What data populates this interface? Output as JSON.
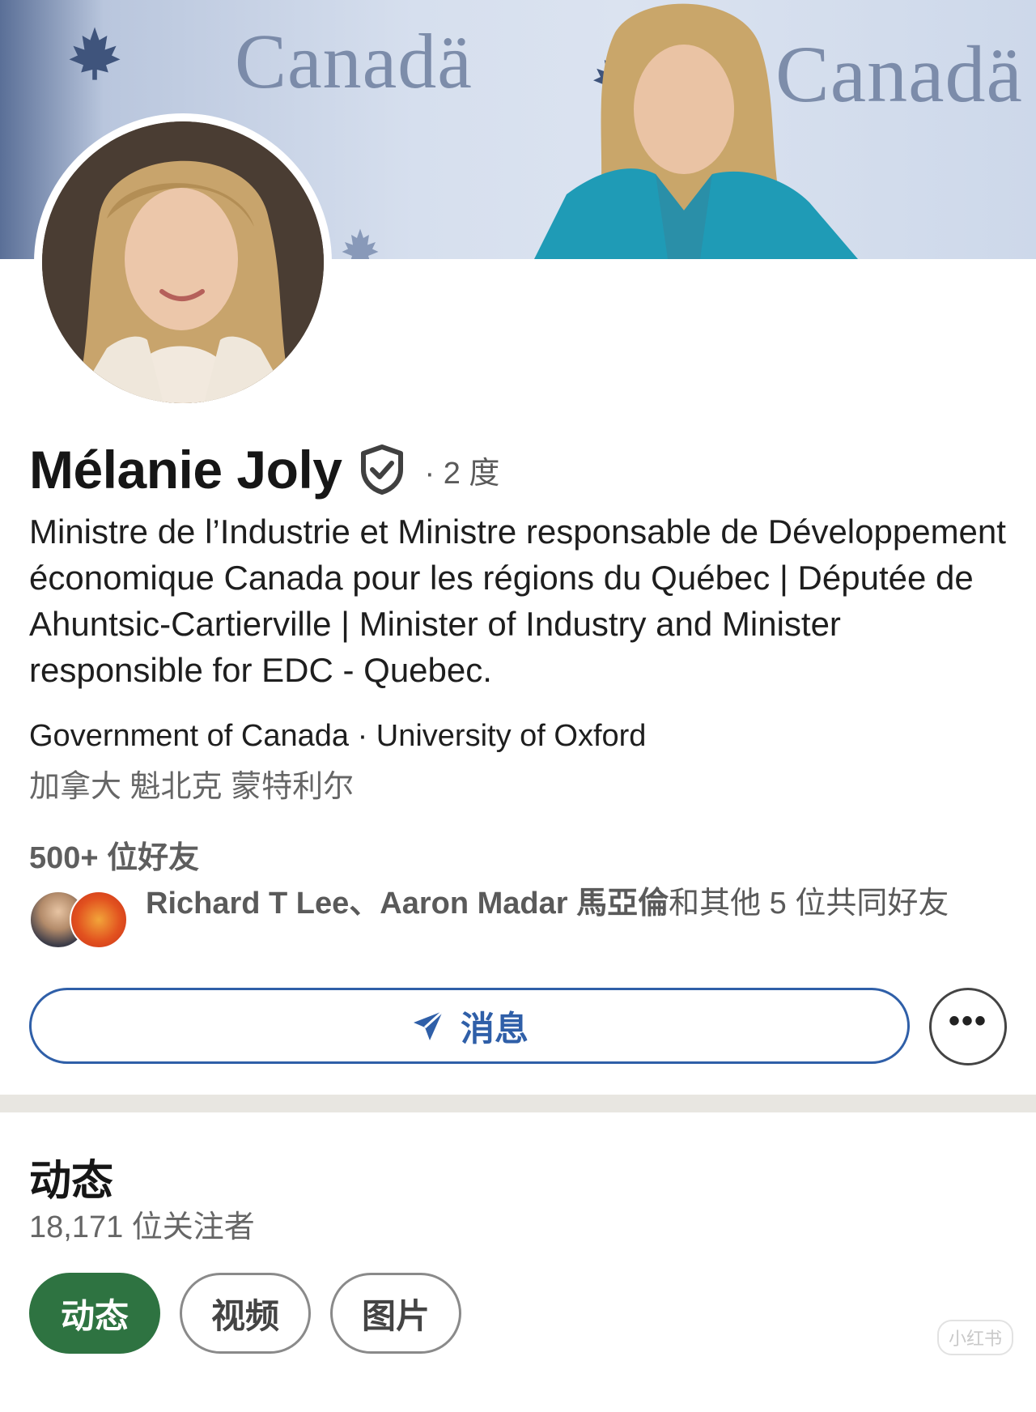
{
  "cover": {
    "banner_text_1": "Canadä",
    "banner_text_2": "Canadä",
    "leaf_icon": "maple-leaf-icon"
  },
  "profile": {
    "name": "Mélanie Joly",
    "verified_icon": "verified-shield-icon",
    "degree": "· 2 度",
    "headline": "Ministre de l’Industrie et Ministre responsable de Développement économique Canada pour les régions du Québec | Députée de Ahuntsic-Cartierville  | Minister of Industry and Minister responsible for EDC - Quebec.",
    "organization": "Government of Canada · University of Oxford",
    "location": "加拿大 魁北克 蒙特利尔",
    "connections": "500+ 位好友",
    "mutual_names": "Richard T Lee、Aaron Madar 馬亞倫",
    "mutual_rest": "和其他 5 位共同好友"
  },
  "actions": {
    "message_label": "消息",
    "message_icon": "send-icon",
    "more_icon": "more-icon",
    "more_label": "•••"
  },
  "activity": {
    "title": "动态",
    "followers": "18,171 位关注者",
    "tabs": [
      {
        "label": "动态",
        "active": true
      },
      {
        "label": "视频",
        "active": false
      },
      {
        "label": "图片",
        "active": false
      }
    ]
  },
  "watermark": "小红书",
  "colors": {
    "brand_blue": "#2f5fa8",
    "active_green": "#2e7341",
    "divider": "#e8e6e1"
  }
}
